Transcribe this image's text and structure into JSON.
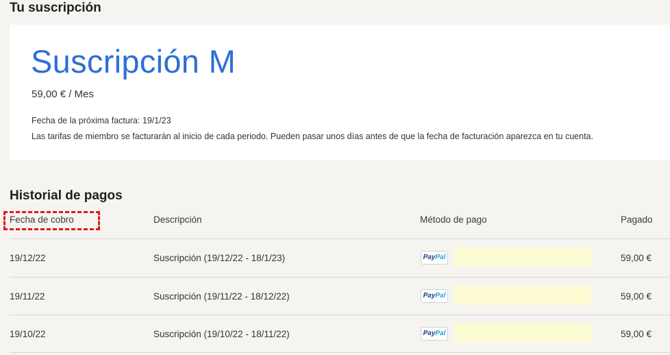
{
  "subscription": {
    "heading": "Tu suscripción",
    "plan_name": "Suscripción M",
    "price": "59,00 € / Mes",
    "next_invoice": "Fecha de la próxima factura: 19/1/23",
    "billing_note": "Las tarifas de miembro se facturarán al inicio de cada periodo. Pueden pasar unos días antes de que la fecha de facturación aparezca en tu cuenta."
  },
  "history": {
    "heading": "Historial de pagos",
    "columns": {
      "date": "Fecha de cobro",
      "description": "Descripción",
      "method": "Método de pago",
      "paid": "Pagado"
    },
    "rows": [
      {
        "date": "19/12/22",
        "description": "Suscripción (19/12/22 - 18/1/23)",
        "method_brand": [
          "Pay",
          "Pal"
        ],
        "paid": "59,00 €"
      },
      {
        "date": "19/11/22",
        "description": "Suscripción (19/11/22 - 18/12/22)",
        "method_brand": [
          "Pay",
          "Pal"
        ],
        "paid": "59,00 €"
      },
      {
        "date": "19/10/22",
        "description": "Suscripción (19/10/22 - 18/11/22)",
        "method_brand": [
          "Pay",
          "Pal"
        ],
        "paid": "59,00 €"
      }
    ]
  },
  "colors": {
    "accent_blue": "#2d6fd6",
    "highlight_red": "#e01b1b",
    "redaction_yellow": "#fdfbd2"
  }
}
